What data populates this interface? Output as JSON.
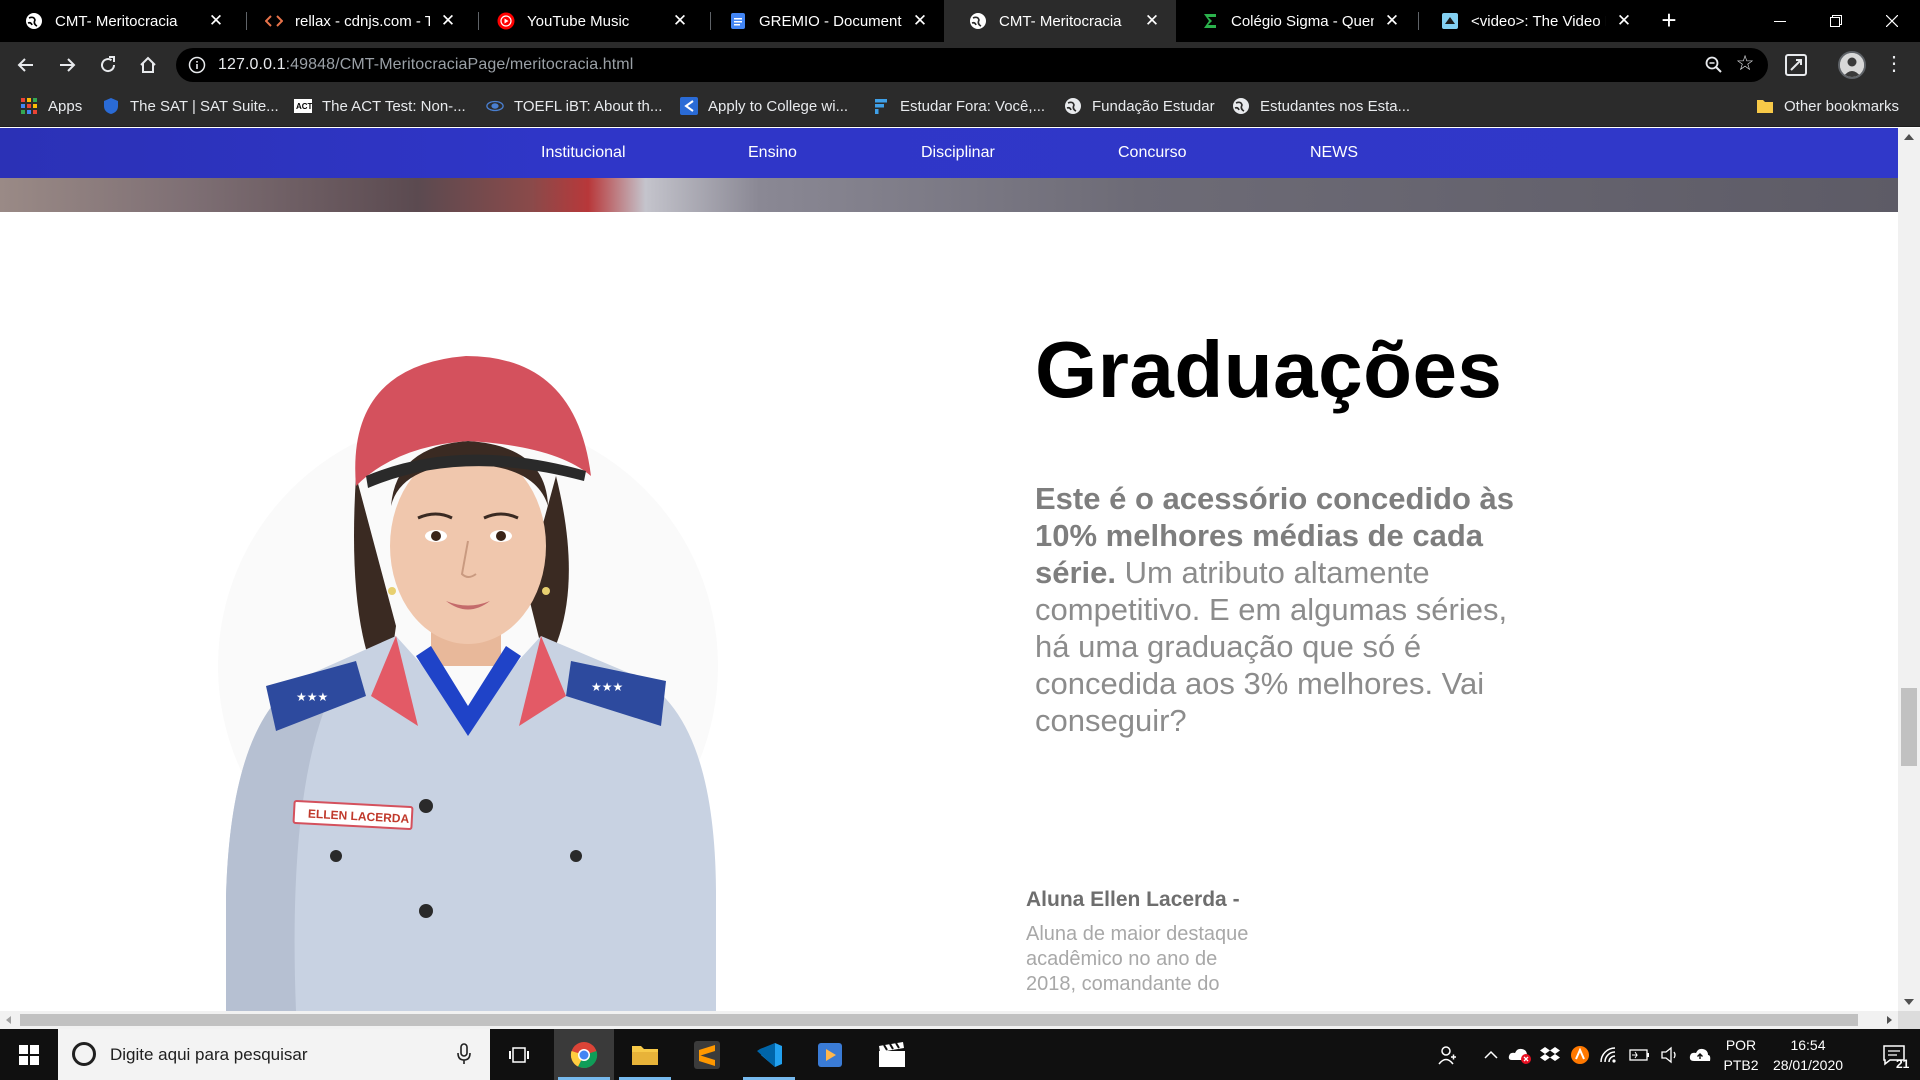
{
  "browser": {
    "tabs": [
      {
        "title": "CMT- Meritocracia",
        "icon": "globe-icon",
        "active": false
      },
      {
        "title": "rellax - cdnjs.com - The",
        "icon": "code-icon",
        "active": false
      },
      {
        "title": "YouTube Music",
        "icon": "youtube-music-icon",
        "active": false
      },
      {
        "title": "GREMIO - Documentos",
        "icon": "google-docs-icon",
        "active": false
      },
      {
        "title": "CMT- Meritocracia",
        "icon": "globe-icon",
        "active": true
      },
      {
        "title": "Colégio Sigma - Quem",
        "icon": "sigma-icon",
        "active": false
      },
      {
        "title": "<video>: The Video Em",
        "icon": "mdn-icon",
        "active": false
      }
    ],
    "new_tab_label": "+",
    "url": "127.0.0.1:49848/CMT-MeritocraciaPage/meritocracia.html",
    "url_host": "127.0.0.1",
    "url_rest": ":49848/CMT-MeritocraciaPage/meritocracia.html",
    "bookmarks": [
      {
        "label": "Apps",
        "icon": "apps-grid-icon"
      },
      {
        "label": "The SAT | SAT Suite...",
        "icon": "shield-icon"
      },
      {
        "label": "The ACT Test: Non-...",
        "icon": "act-icon"
      },
      {
        "label": "TOEFL iBT: About th...",
        "icon": "toefl-icon"
      },
      {
        "label": "Apply to College wi...",
        "icon": "commonapp-icon"
      },
      {
        "label": "Estudar Fora: Você,...",
        "icon": "estudar-fora-icon"
      },
      {
        "label": "Fundação Estudar",
        "icon": "globe-icon"
      },
      {
        "label": "Estudantes nos Esta...",
        "icon": "globe-icon"
      }
    ],
    "other_bookmarks": "Other bookmarks"
  },
  "site": {
    "nav": [
      "Institucional",
      "Ensino",
      "Disciplinar",
      "Concurso",
      "NEWS"
    ],
    "heading": "Graduações",
    "desc_bold": "Este é o acessório concedido às 10% melhores médias de cada série.",
    "desc_rest": " Um atributo altamente competitivo. E em algumas séries, há uma graduação que só é concedida aos 3% melhores. Vai conseguir?",
    "student_name": "Aluna Ellen Lacerda -",
    "student_desc": "Aluna de maior destaque acadêmico no ano de 2018, comandante do",
    "photo_name_tag": "ELLEN LACERDA",
    "colors": {
      "nav_blue": "#2f36c8",
      "beret": "#d4515d",
      "shirt": "#c8d2e2"
    }
  },
  "taskbar": {
    "search_placeholder": "Digite aqui para pesquisar",
    "lang_line1": "POR",
    "lang_line2": "PTB2",
    "time": "16:54",
    "date": "28/01/2020",
    "notifications": "21"
  }
}
